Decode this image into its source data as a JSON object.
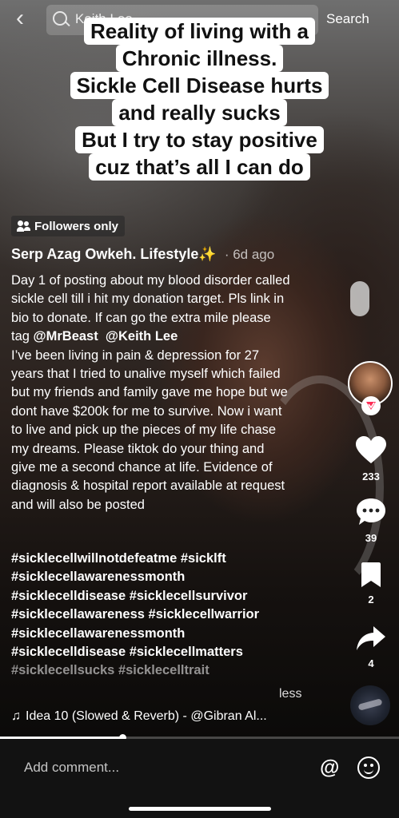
{
  "search": {
    "query": "Keith Lee",
    "button_label": "Search"
  },
  "caption": {
    "lines": [
      "Reality of living with a",
      "Chronic illness.",
      "Sickle Cell Disease hurts",
      "and really sucks",
      "But I try to stay positive",
      "cuz that’s all I can do"
    ]
  },
  "badge": {
    "followers_only": "Followers only"
  },
  "post": {
    "author": "Serp Azag Owkeh. Lifestyle✨",
    "time": "· 6d ago",
    "description_before": "Day 1 of posting about my blood disorder called sickle cell till i hit my donation target. Pls link in bio to donate. If can go the extra mile please tag ",
    "mention_1": "@MrBeast",
    "mention_2": "@Keith Lee",
    "description_after": "I’ve been living in pain & depression for 27 years that I tried to unalive myself which failed but my friends and family gave me hope but we dont have $200k for me to survive. Now i want to live and pick up the pieces of my life chase my dreams. Please tiktok do your thing and give me a second chance at life. Evidence of diagnosis & hospital report available at request and will also be posted",
    "hashtags": [
      "#sicklecellwillnotdefeatme #sicklft",
      "#sicklecellawarenessmonth",
      "#sicklecelldisease #sicklecellsurvivor",
      "#sicklecellawareness #sicklecellwarrior",
      "#sicklecellawarenessmonth",
      "#sicklecelldisease #sicklecellmatters"
    ],
    "hashtag_faded": "#sicklecellsucks #sicklecelltrait",
    "less_label": "less"
  },
  "actions": {
    "likes": "233",
    "comments": "39",
    "saves": "2",
    "shares": "4"
  },
  "music": {
    "title": "Idea 10 (Slowed & Reverb) - @Gibran Al..."
  },
  "progress": {
    "fraction": 0.307
  },
  "comment": {
    "placeholder": "Add comment..."
  },
  "colors": {
    "accent_red": "#fe2c55",
    "caption_bg": "#ffffff",
    "comment_bar_bg": "#121212"
  }
}
